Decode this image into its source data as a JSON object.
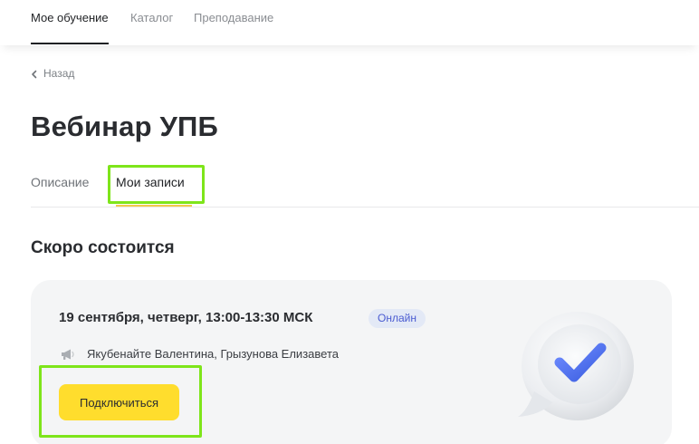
{
  "nav": {
    "items": [
      {
        "label": "Мое обучение",
        "active": true
      },
      {
        "label": "Каталог",
        "active": false
      },
      {
        "label": "Преподавание",
        "active": false
      }
    ]
  },
  "back": {
    "label": "Назад",
    "icon": "chevron-left-icon"
  },
  "page": {
    "title": "Вебинар УПБ"
  },
  "tabs": [
    {
      "label": "Описание",
      "active": false
    },
    {
      "label": "Мои записи",
      "active": true
    }
  ],
  "section": {
    "title": "Скоро состоится"
  },
  "event": {
    "datetime": "19 сентября, четверг, 13:00-13:30 МСК",
    "badge": "Онлайн",
    "speakers_icon": "megaphone-icon",
    "speakers": "Якубенайте Валентина, Грызунова Елизавета",
    "connect_label": "Подключиться",
    "illustration": "chat-bubble-checkmark-icon"
  },
  "colors": {
    "accent_yellow": "#ffdd2d",
    "tab_underline": "#f2c94c",
    "badge_bg": "#e3e9f6",
    "badge_text": "#4a5bd1",
    "highlight": "#7ee51a",
    "card_bg": "#f4f5f6"
  }
}
